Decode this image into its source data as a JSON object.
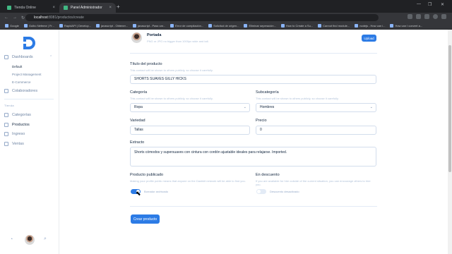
{
  "browser": {
    "tabs": [
      {
        "label": "Tienda Online"
      },
      {
        "label": "Panel Administrador"
      }
    ],
    "url_host": "localhost",
    "url_path": ":8081/productos/create",
    "bookmarks": [
      "Google",
      "Gulbo Nefeme | Fr...",
      "RapidAPI | Develop...",
      "javascript - Obtener...",
      "javascript - Pass var...",
      "Error de compilación...",
      "Solicitud de origen...",
      "Eliminar seperación...",
      "How to Create a Su...",
      "Cannot find module...",
      "nodejs - How can i...",
      "How can I convert a..."
    ]
  },
  "sidebar": {
    "dashboards_label": "Dashboards",
    "dashboard_subs": [
      "Default",
      "Project Management",
      "E-Commerce"
    ],
    "collaborators_label": "Colaboradores",
    "section_label": "Tienda",
    "items": [
      "Categorías",
      "Productos",
      "Ingreso",
      "Ventas"
    ]
  },
  "form": {
    "cover_title": "Portada",
    "cover_hint": "PNG or JPG no bigger than 1000px wide and tall.",
    "upload_label": "Upload",
    "title_label": "Título del producto",
    "title_hint": "This contact will be shown to others publicly, so choose it carefully.",
    "title_value": "SHORTS SUAVES GILLY HICKS",
    "category_label": "Categoría",
    "category_hint": "This contact will be shown to others publicly, so choose it carefully.",
    "category_value": "Ropa",
    "subcategory_label": "Subcategoría",
    "subcategory_hint": "This contact will be shown to others publicly, so choose it carefully.",
    "subcategory_value": "Hombres",
    "variety_label": "Variedad",
    "variety_value": "Tallas",
    "price_label": "Precio",
    "price_value": "0",
    "excerpt_label": "Extracto",
    "excerpt_value": "Shorts cómodos y supersuaves con cintura con cordón ajustable ideales para relajarse. Imported.",
    "published_label": "Producto publicado",
    "published_hint": "Making your profile public means that anyone on the Dashkit network will be able to find you.",
    "published_toggle_label": "Borrador archivado",
    "published_on": true,
    "discount_label": "En descuento",
    "discount_hint": "If you are available for hire outside of the current situation, you can encourage others to hire you.",
    "discount_toggle_label": "Descuento desactivado",
    "discount_on": false,
    "submit_label": "Crear producto"
  },
  "colors": {
    "primary": "#2c7be5",
    "heading": "#12263f",
    "muted": "#95aac9"
  }
}
